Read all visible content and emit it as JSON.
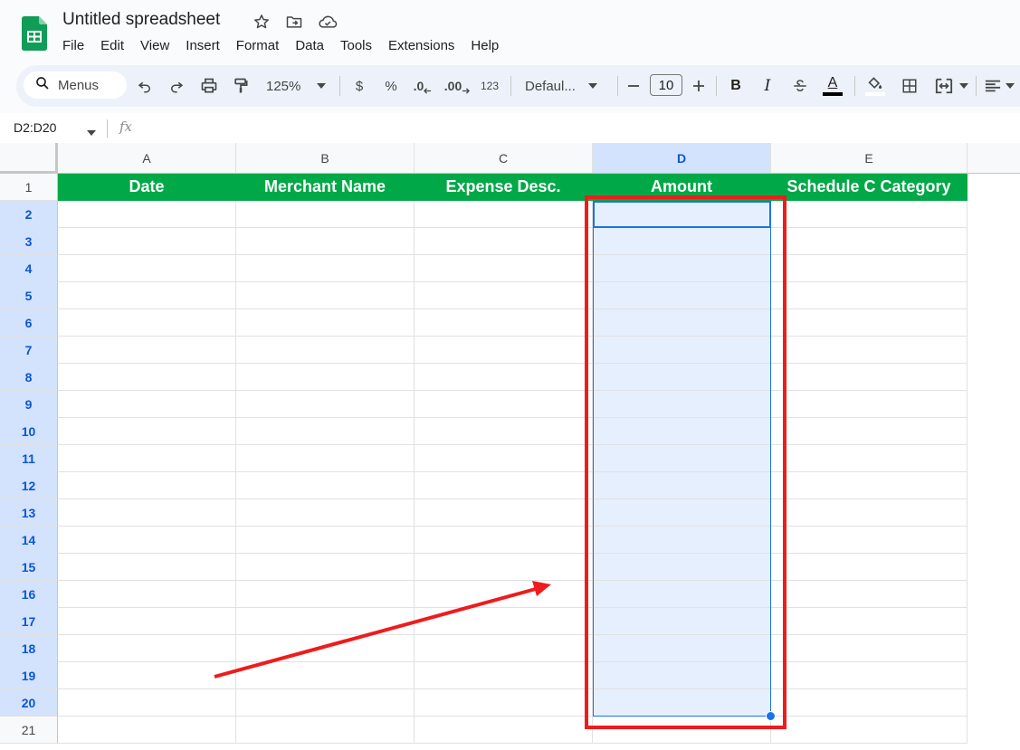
{
  "app": {
    "title": "Untitled spreadsheet"
  },
  "menu": [
    "File",
    "Edit",
    "View",
    "Insert",
    "Format",
    "Data",
    "Tools",
    "Extensions",
    "Help"
  ],
  "toolbar": {
    "search_label": "Menus",
    "zoom": "125%",
    "currency": "$",
    "percent": "%",
    "decrease_decimal": ".0",
    "increase_decimal": ".00",
    "number_format": "123",
    "font": "Defaul...",
    "font_size": "10",
    "bold": "B",
    "italic": "I",
    "text_color": "A"
  },
  "formula_bar": {
    "name_box": "D2:D20",
    "fx": "fx",
    "value": ""
  },
  "sheet": {
    "columns": [
      "A",
      "B",
      "C",
      "D",
      "E"
    ],
    "rows": [
      "1",
      "2",
      "3",
      "4",
      "5",
      "6",
      "7",
      "8",
      "9",
      "10",
      "11",
      "12",
      "13",
      "14",
      "15",
      "16",
      "17",
      "18",
      "19",
      "20",
      "21"
    ],
    "header_row": [
      "Date",
      "Merchant Name",
      "Expense Desc.",
      "Amount",
      "Schedule C Category"
    ],
    "selected_range": "D2:D20",
    "header_fill": "#00a847",
    "selection_color": "#1a73e8"
  },
  "annotation": {
    "color": "#ee1c1c"
  }
}
